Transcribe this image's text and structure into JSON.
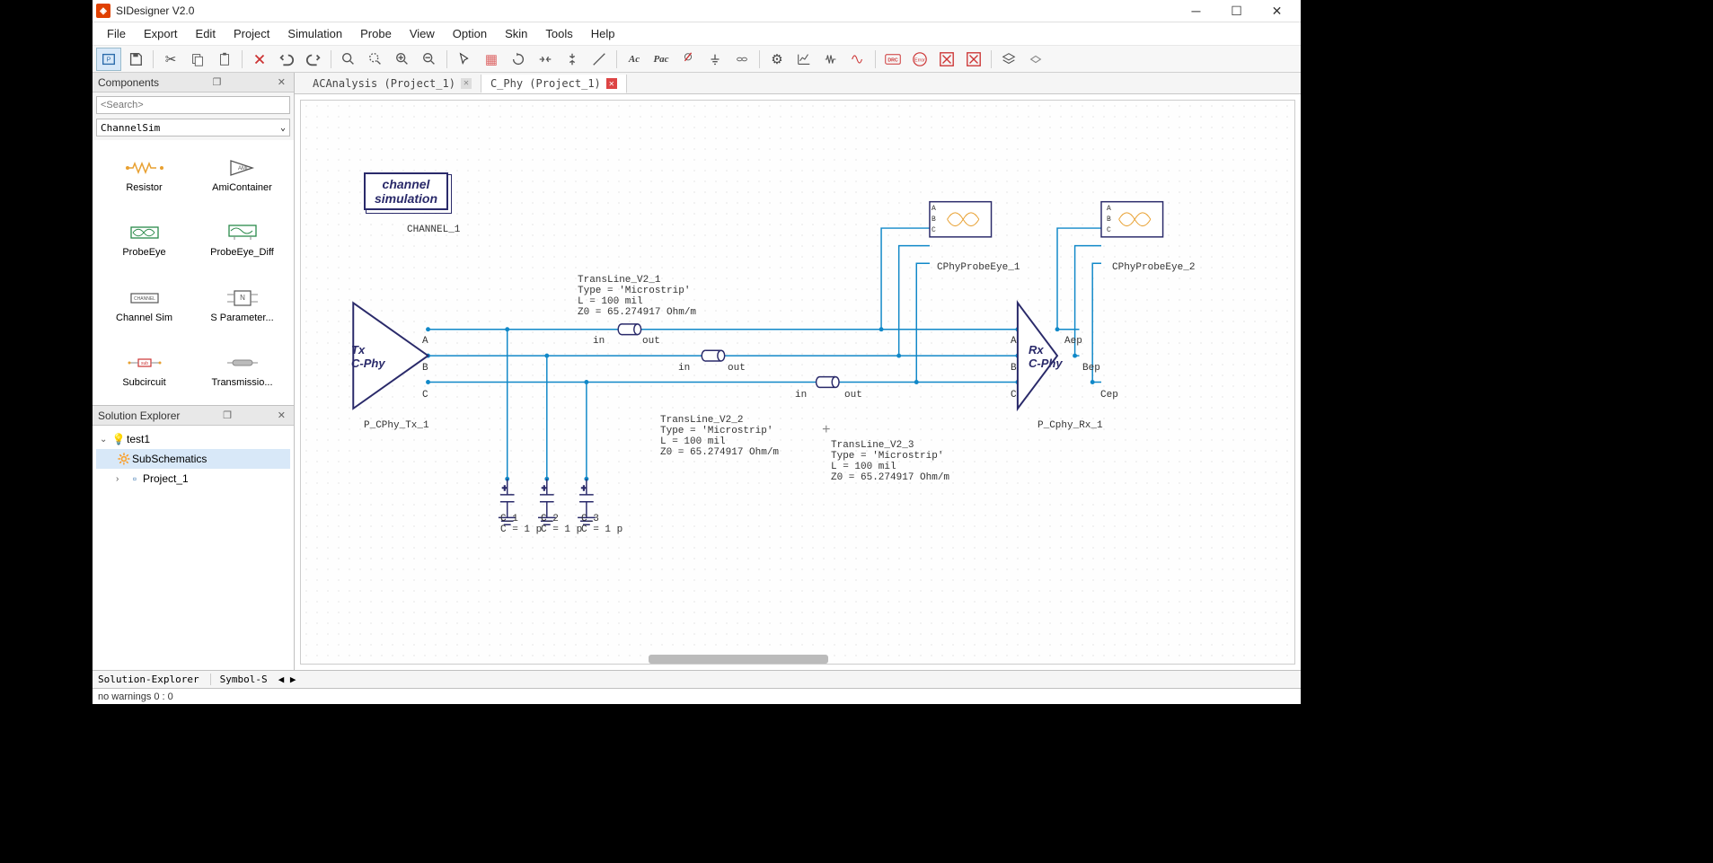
{
  "app": {
    "title": "SIDesigner V2.0"
  },
  "menu": [
    "File",
    "Export",
    "Edit",
    "Project",
    "Simulation",
    "Probe",
    "View",
    "Option",
    "Skin",
    "Tools",
    "Help"
  ],
  "panels": {
    "components": "Components",
    "solution": "Solution Explorer"
  },
  "search": {
    "placeholder": "<Search>"
  },
  "category": "ChannelSim",
  "components": [
    {
      "name": "Resistor"
    },
    {
      "name": "AmiContainer"
    },
    {
      "name": "ProbeEye"
    },
    {
      "name": "ProbeEye_Diff"
    },
    {
      "name": "Channel Sim"
    },
    {
      "name": "S Parameter..."
    },
    {
      "name": "Subcircuit"
    },
    {
      "name": "Transmissio..."
    }
  ],
  "tree": {
    "root": "test1",
    "sub": "SubSchematics",
    "proj": "Project_1"
  },
  "tabs": [
    {
      "label": "ACAnalysis (Project_1)",
      "active": false
    },
    {
      "label": "C_Phy (Project_1)",
      "active": true
    }
  ],
  "schematic": {
    "title1": "channel",
    "title2": "simulation",
    "title_name": "CHANNEL_1",
    "tx_label": "Tx\nC-Phy",
    "tx_name": "P_CPhy_Tx_1",
    "rx_label": "Rx\nC-Phy",
    "rx_name": "P_Cphy_Rx_1",
    "portA": "A",
    "portB": "B",
    "portC": "C",
    "portAep": "Aep",
    "portBep": "Bep",
    "portCep": "Cep",
    "in": "in",
    "out": "out",
    "tl1": "TransLine_V2_1\nType = 'Microstrip'\nL = 100 mil\nZ0 = 65.274917 Ohm/m",
    "tl2": "TransLine_V2_2\nType = 'Microstrip'\nL = 100 mil\nZ0 = 65.274917 Ohm/m",
    "tl3": "TransLine_V2_3\nType = 'Microstrip'\nL = 100 mil\nZ0 = 65.274917 Ohm/m",
    "pe1": "CPhyProbeEye_1",
    "pe1_a": "A",
    "pe1_b": "B",
    "pe1_c": "C",
    "pe2": "CPhyProbeEye_2",
    "pe2_a": "A",
    "pe2_b": "B",
    "pe2_c": "C",
    "c1": "C_1\nC = 1 p",
    "c2": "C_2\nC = 1 p",
    "c3": "C_3\nC = 1 p"
  },
  "statusTabs": {
    "a": "Solution-Explorer",
    "b": "Symbol-S",
    "nav": "◀ ▶"
  },
  "status": "no warnings 0 : 0"
}
